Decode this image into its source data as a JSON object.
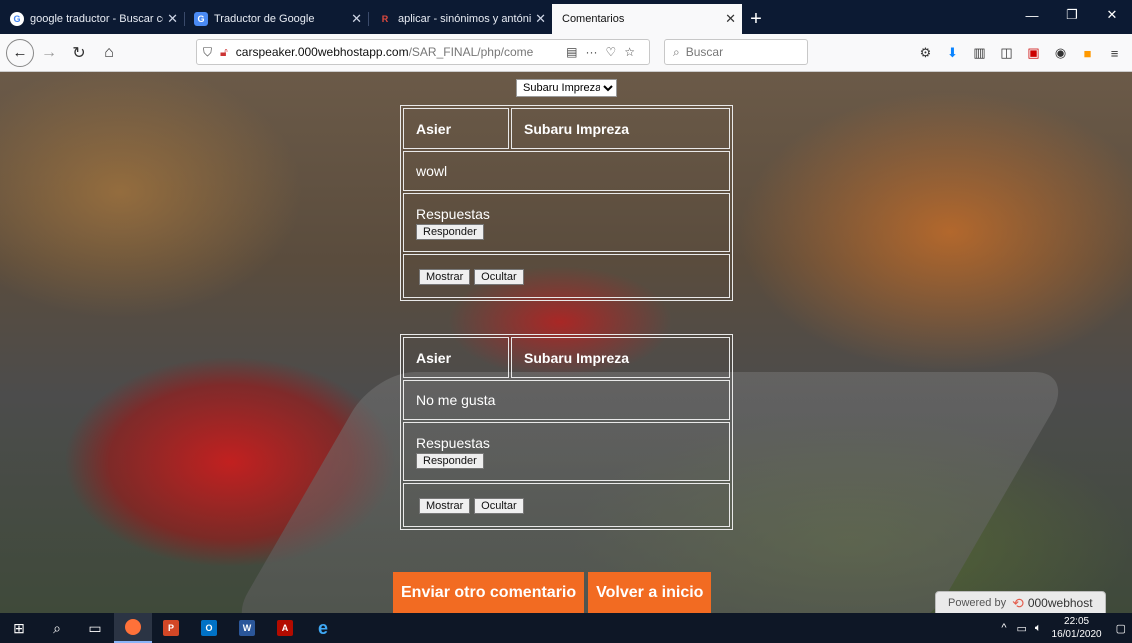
{
  "browser": {
    "tabs": [
      {
        "title": "google traductor - Buscar con",
        "fav": "G",
        "fav_color": "#4285f4"
      },
      {
        "title": "Traductor de Google",
        "fav": "G",
        "fav_color": "#4a8af4"
      },
      {
        "title": "aplicar - sinónimos y antónimo",
        "fav": "R",
        "fav_color": "#e04a3f"
      },
      {
        "title": "Comentarios",
        "fav": "",
        "fav_color": ""
      }
    ],
    "new_tab": "+",
    "win_min": "—",
    "win_max": "❐",
    "win_close": "✕",
    "url_host": "carspeaker.000webhostapp.com",
    "url_path": "/SAR_FINAL/php/come",
    "search_placeholder": "Buscar"
  },
  "page": {
    "selected_car": "Subaru Impreza",
    "car_options": [
      "Subaru Impreza"
    ],
    "comments": [
      {
        "user": "Asier",
        "car": "Subaru Impreza",
        "text": "wowl",
        "responses_label": "Respuestas",
        "reply_label": "Responder",
        "show_label": "Mostrar",
        "hide_label": "Ocultar"
      },
      {
        "user": "Asier",
        "car": "Subaru Impreza",
        "text": "No me gusta",
        "responses_label": "Respuestas",
        "reply_label": "Responder",
        "show_label": "Mostrar",
        "hide_label": "Ocultar"
      }
    ],
    "send_another": "Enviar otro comentario",
    "back_home": "Volver a inicio",
    "powered_by": "Powered by",
    "powered_brand": "000webhost"
  },
  "taskbar": {
    "time": "22:05",
    "date": "16/01/2020"
  },
  "colors": {
    "accent_orange": "#f26b22",
    "tabbar_bg": "#0c1a33",
    "taskbar_bg": "#0e1726"
  }
}
